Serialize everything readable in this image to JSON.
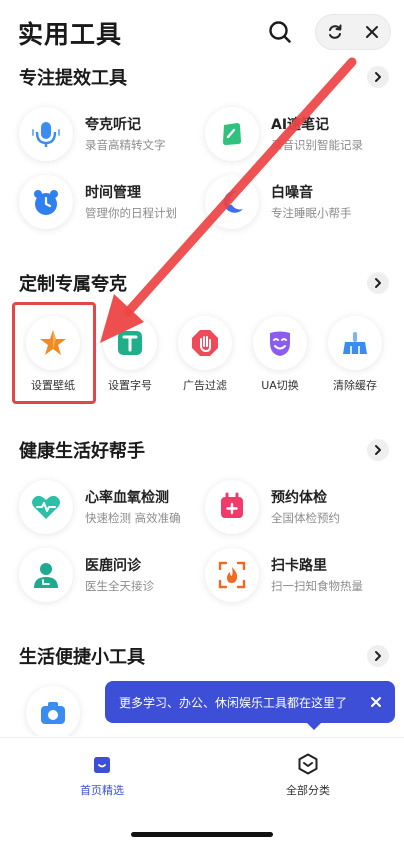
{
  "header": {
    "title": "实用工具",
    "icons": {
      "search": "search-icon",
      "refresh": "refresh-icon",
      "close": "close-icon"
    }
  },
  "sections": {
    "focus": {
      "title": "专注提效工具",
      "tools": [
        {
          "title": "夸克听记",
          "subtitle": "录音高精转文字",
          "icon": "microphone-icon",
          "color": "#3b8cf0"
        },
        {
          "title": "AI速笔记",
          "subtitle": "录音识别智能记录",
          "icon": "note-icon",
          "color": "#2ec27e"
        },
        {
          "title": "时间管理",
          "subtitle": "管理你的日程计划",
          "icon": "alarm-clock-icon",
          "color": "#2f7ff0"
        },
        {
          "title": "白噪音",
          "subtitle": "专注睡眠小帮手",
          "icon": "sleep-icon",
          "color": "#3d6df0"
        }
      ]
    },
    "custom": {
      "title": "定制专属夸克",
      "items": [
        {
          "label": "设置壁纸",
          "icon": "wallpaper-icon",
          "color": "#f08a24"
        },
        {
          "label": "设置字号",
          "icon": "font-size-icon",
          "color": "#1fb08a"
        },
        {
          "label": "广告过滤",
          "icon": "ad-block-hand-icon",
          "color": "#f04a5a"
        },
        {
          "label": "UA切换",
          "icon": "mask-icon",
          "color": "#8a5cf0"
        },
        {
          "label": "清除缓存",
          "icon": "broom-icon",
          "color": "#3b8cf0"
        }
      ]
    },
    "health": {
      "title": "健康生活好帮手",
      "tools": [
        {
          "title": "心率血氧检测",
          "subtitle": "快速检测 高效准确",
          "icon": "heart-pulse-icon",
          "color": "#2dbfa7"
        },
        {
          "title": "预约体检",
          "subtitle": "全国体检预约",
          "icon": "calendar-plus-icon",
          "color": "#f03a6a"
        },
        {
          "title": "医鹿问诊",
          "subtitle": "医生全天接诊",
          "icon": "doctor-icon",
          "color": "#1fa98e"
        },
        {
          "title": "扫卡路里",
          "subtitle": "扫一扫知食物热量",
          "icon": "scan-flame-icon",
          "color": "#f06a24"
        }
      ]
    },
    "life": {
      "title": "生活便捷小工具"
    }
  },
  "tooltip": {
    "text": "更多学习、办公、休闲娱乐工具都在这里了"
  },
  "nav": {
    "items": [
      {
        "label": "首页精选",
        "icon": "home-bag-icon",
        "active": true
      },
      {
        "label": "全部分类",
        "icon": "hexagon-icon",
        "active": false
      }
    ],
    "accent": "#3d4fd6"
  },
  "annotation": {
    "arrow_color": "#ee4444",
    "box_color": "#e04848"
  }
}
